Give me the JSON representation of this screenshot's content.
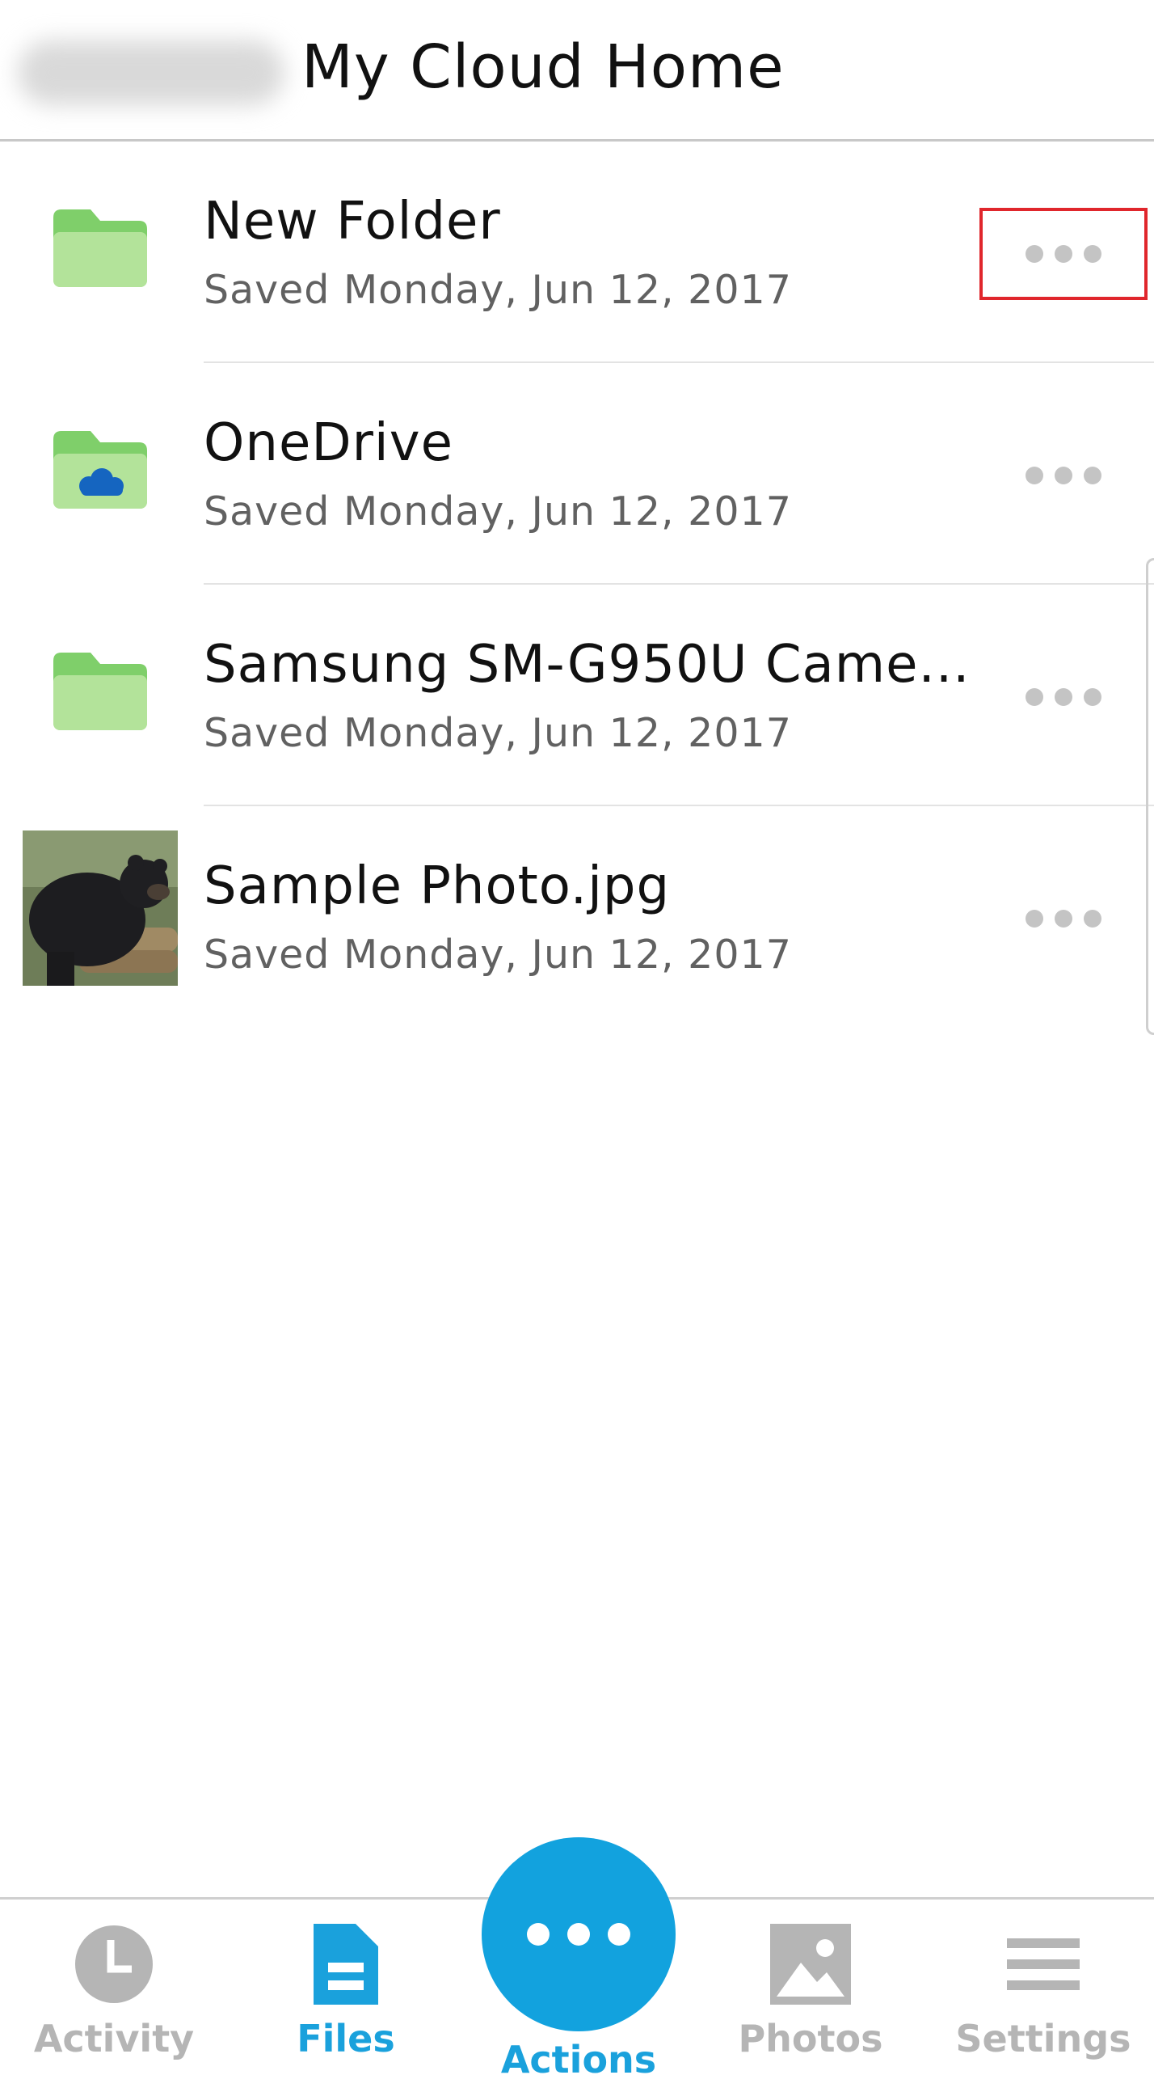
{
  "header": {
    "title": "My Cloud Home"
  },
  "files": [
    {
      "name": "New Folder",
      "date": "Saved Monday, Jun 12, 2017",
      "type": "folder"
    },
    {
      "name": "OneDrive",
      "date": "Saved Monday, Jun 12, 2017",
      "type": "onedrive-folder"
    },
    {
      "name": "Samsung SM-G950U Came...",
      "date": "Saved Monday, Jun 12, 2017",
      "type": "folder"
    },
    {
      "name": "Sample Photo.jpg",
      "date": "Saved Monday, Jun 12, 2017",
      "type": "photo"
    }
  ],
  "nav": {
    "activity": "Activity",
    "files": "Files",
    "actions": "Actions",
    "photos": "Photos",
    "settings": "Settings"
  },
  "colors": {
    "accent": "#12a2de",
    "folder": "#b3e39a",
    "highlight": "#e0262c",
    "onedrive": "#1565c0"
  }
}
